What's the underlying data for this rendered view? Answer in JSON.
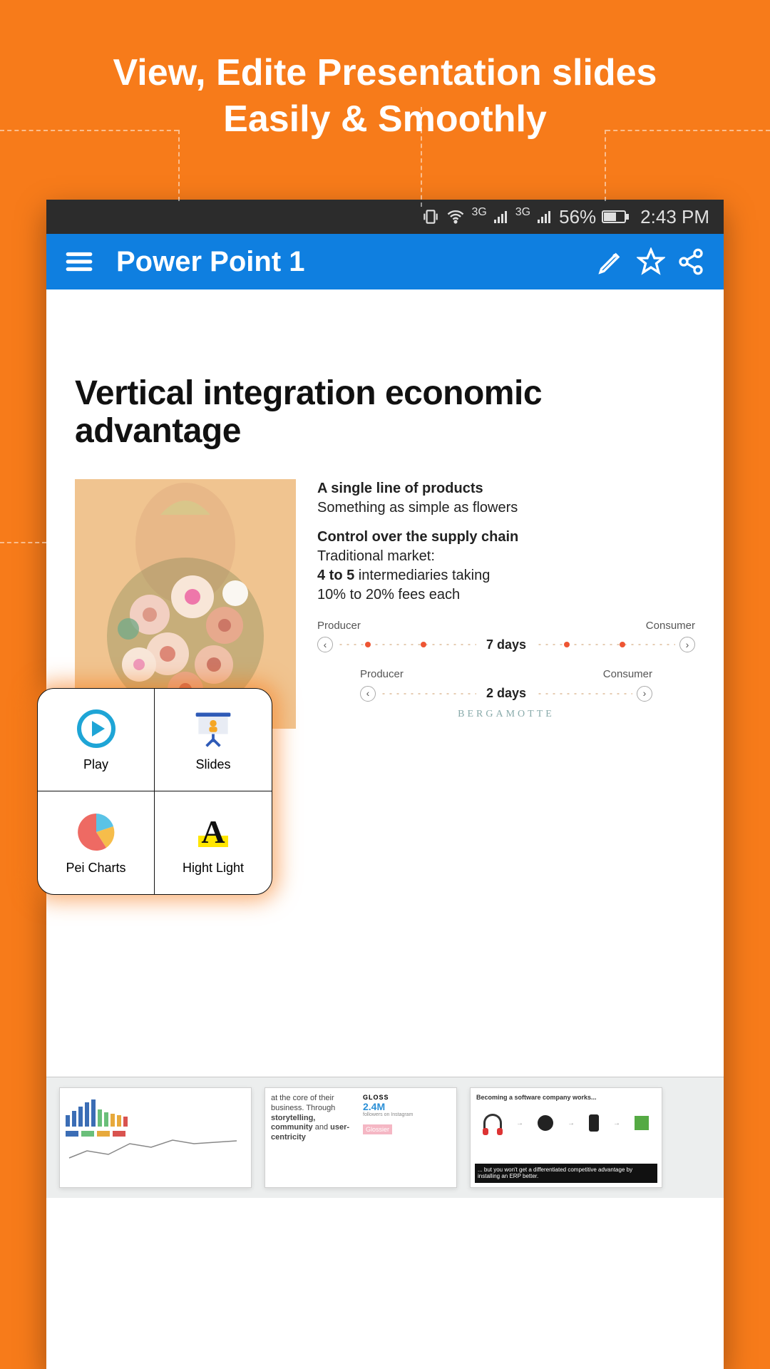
{
  "marketing": {
    "headline_l1": "View, Edite Presentation slides",
    "headline_l2": "Easily & Smoothly"
  },
  "status_bar": {
    "battery_pct": "56%",
    "time": "2:43 PM",
    "net_label": "3G"
  },
  "app_bar": {
    "title": "Power Point 1"
  },
  "slide": {
    "title": "Vertical integration economic advantage",
    "h1": "A single line of products",
    "p1": "Something as simple as flowers",
    "h2": "Control over the supply chain",
    "p2": "Traditional market:",
    "p3_a": "4 to 5",
    "p3_b": " intermediaries taking",
    "p4": "10% to 20% fees each",
    "timeline1": {
      "left": "Producer",
      "right": "Consumer",
      "center": "7 days"
    },
    "timeline2": {
      "left": "Producer",
      "right": "Consumer",
      "center": "2 days"
    },
    "brand": "BERGAMOTTE"
  },
  "tools": {
    "play": "Play",
    "slides": "Slides",
    "pei": "Pei Charts",
    "highlight": "Hight Light"
  },
  "thumbs": {
    "t2_a": "at the core of their business. Through",
    "t2_b": "storytelling, community",
    "t2_c": "and",
    "t2_d": "user-centricity",
    "t2_gloss": "GLOSS",
    "t2_num": "2.4M",
    "t2_sub": "followers on Instagram",
    "t2_box": "Glossier",
    "t3_title": "Becoming a software company works...",
    "t3_band": "... but you won't get a differentiated competitive advantage by installing an ERP better."
  }
}
